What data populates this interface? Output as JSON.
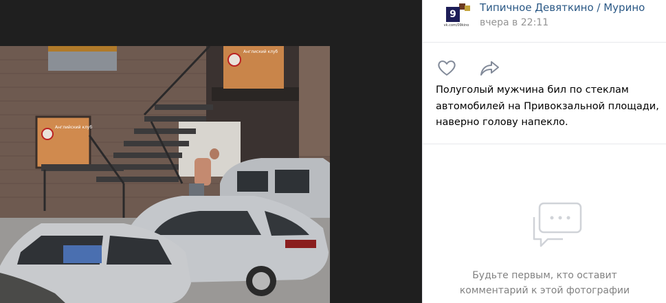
{
  "post": {
    "group_name": "Типичное Девяткино / Мурино",
    "time": "вчера в 22:11",
    "avatar_number": "9",
    "avatar_caption": "vk.com/09kino",
    "text": "Полуголый мужчина бил по стеклам автомобилей на Привокзальной площади, наверно голову напекло."
  },
  "photo": {
    "sign_top_text": "Англиский клуб",
    "sign_left_text": "Английский клуб"
  },
  "actions": {
    "like_icon": "heart-icon",
    "share_icon": "share-arrow-icon"
  },
  "comments": {
    "empty_line1": "Будьте первым, кто оставит",
    "empty_line2": "комментарий к этой фотографии",
    "icon": "comment-bubble-icon"
  },
  "colors": {
    "viewer_bg": "#1f1f1f",
    "link": "#2a5885",
    "muted": "#939393",
    "border": "#e7e8ec"
  }
}
